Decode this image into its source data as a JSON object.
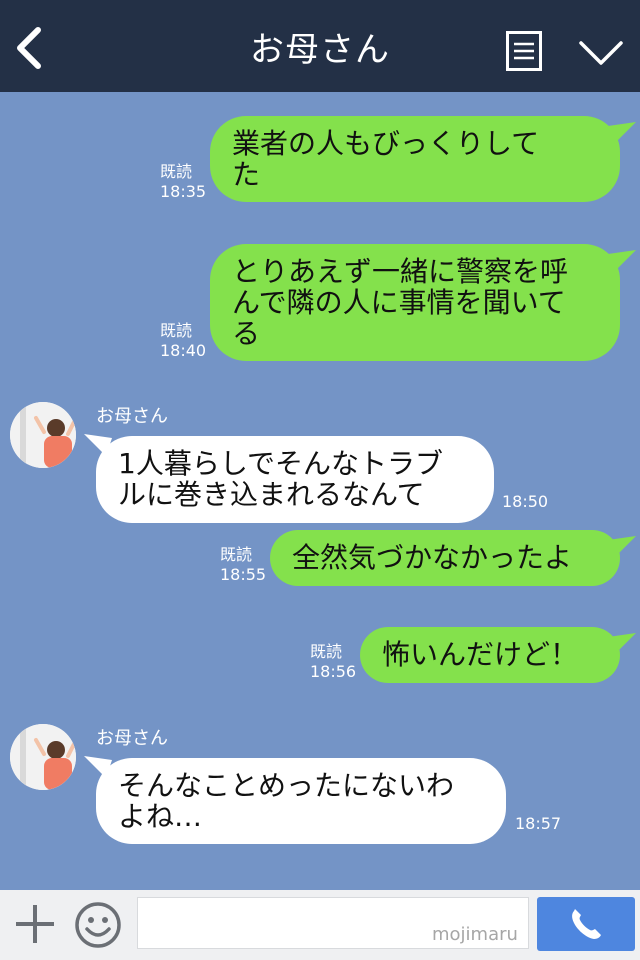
{
  "header": {
    "title": "お母さん"
  },
  "messages": [
    {
      "text": "業者の人もびっくりして\nた",
      "read": "既読",
      "time": "18:35"
    },
    {
      "text": "とりあえず一緒に警察を呼\nんで隣の人に事情を聞いて\nる",
      "read": "既読",
      "time": "18:40"
    },
    {
      "sender": "お母さん",
      "text": "1人暮らしでそんなトラブ\nルに巻き込まれるなんて",
      "time": "18:50"
    },
    {
      "text": "全然気づかなかったよ",
      "read": "既読",
      "time": "18:55"
    },
    {
      "text": "怖いんだけど！",
      "read": "既読",
      "time": "18:56"
    },
    {
      "sender": "お母さん",
      "text": "そんなことめったにないわ\nよね…",
      "time": "18:57"
    }
  ],
  "footer": {
    "watermark": "mojimaru"
  },
  "colors": {
    "header_bg": "#233046",
    "chat_bg": "#7494c6",
    "my_bubble": "#84e14c",
    "their_bubble": "#ffffff",
    "call_button": "#4e86df"
  },
  "icons": [
    "back-icon",
    "menu-icon",
    "chevron-down-icon",
    "plus-icon",
    "smile-icon",
    "phone-icon"
  ]
}
